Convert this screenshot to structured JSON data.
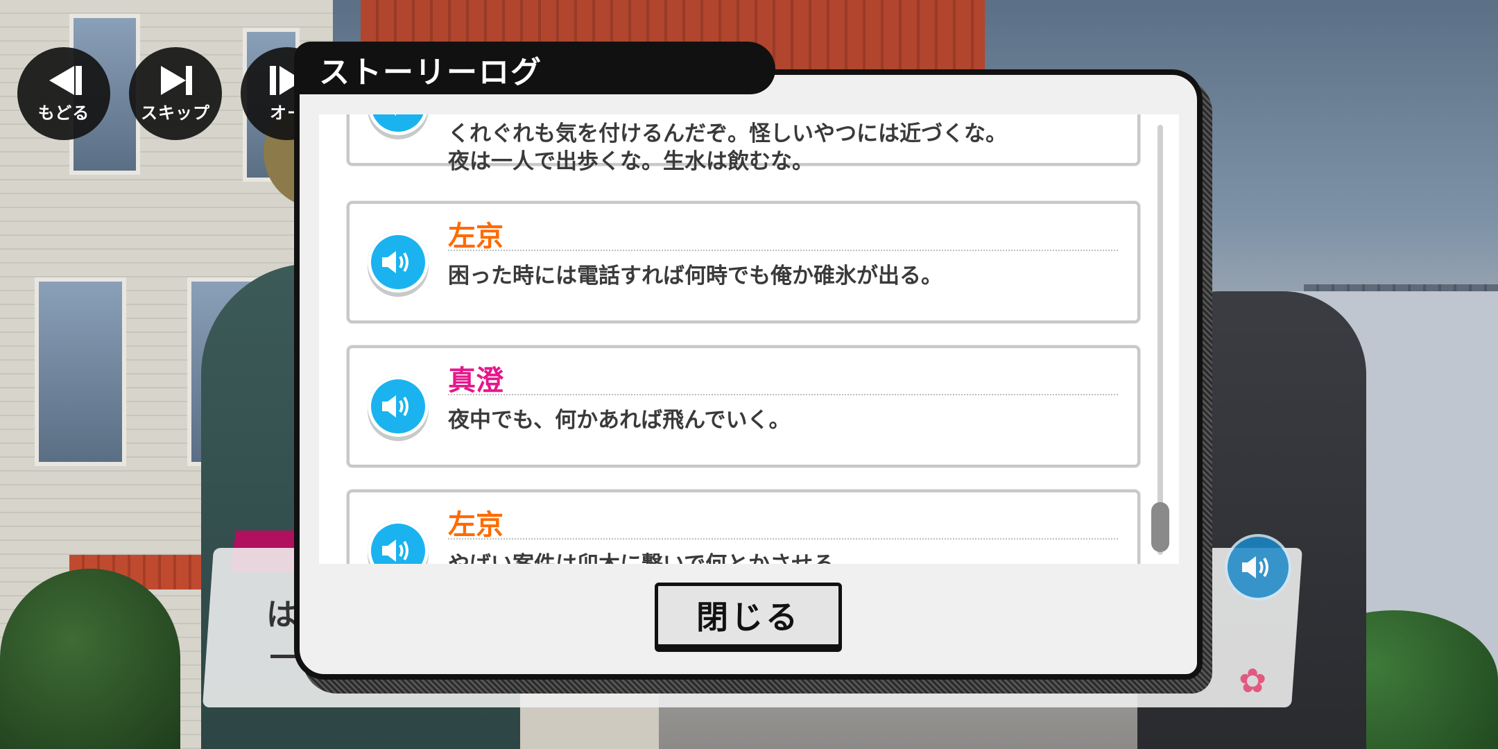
{
  "controls": {
    "back_label": "もどる",
    "skip_label": "スキップ",
    "auto_label": "オー"
  },
  "dialog": {
    "title": "ストーリーログ",
    "close_label": "閉じる"
  },
  "log": [
    {
      "speaker": "",
      "speaker_color": "",
      "lines": [
        "くれぐれも気を付けるんだぞ。怪しいやつには近づくな。",
        "夜は一人で出歩くな。生水は飲むな。"
      ]
    },
    {
      "speaker": "左京",
      "speaker_color": "#ff6a00",
      "lines": [
        "困った時には電話すれば何時でも俺か碓氷が出る。"
      ]
    },
    {
      "speaker": "真澄",
      "speaker_color": "#e6168c",
      "lines": [
        "夜中でも、何かあれば飛んでいく。"
      ]
    },
    {
      "speaker": "左京",
      "speaker_color": "#ff6a00",
      "lines": [
        "やばい案件は卯木に繋いで何とかさせる。"
      ]
    }
  ],
  "message_window": {
    "text": "は"
  },
  "colors": {
    "voice_button": "#1ab3ef",
    "dialog_border": "#111111",
    "name_tab": "#b0105e"
  },
  "icons": {
    "voice": "speaker-icon",
    "back": "rewind-icon",
    "skip": "skip-forward-icon",
    "auto": "auto-play-icon",
    "deco": "sakura-icon"
  }
}
